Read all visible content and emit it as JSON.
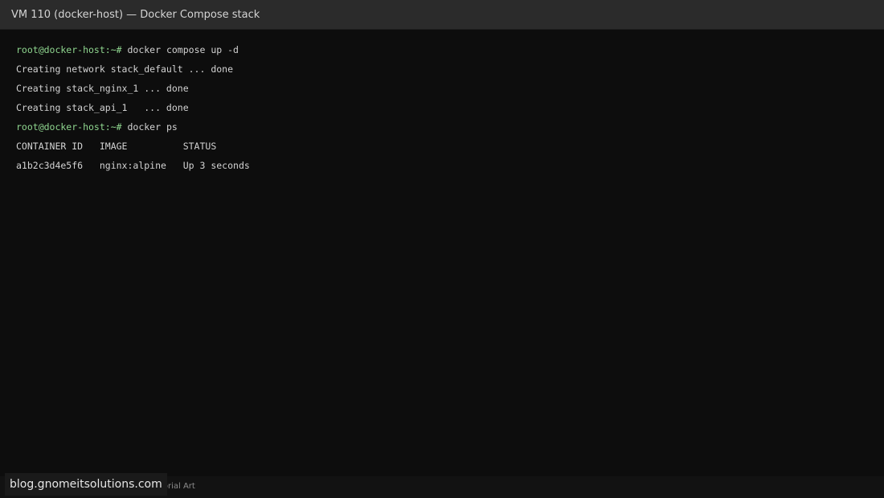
{
  "window": {
    "title": "VM 110 (docker-host) — Docker Compose stack"
  },
  "terminal": {
    "lines": [
      {
        "prompt": "root@docker-host:~#",
        "command": " docker compose up -d"
      },
      {
        "text": "Creating network stack_default ... done"
      },
      {
        "text": "Creating stack_nginx_1 ... done"
      },
      {
        "text": "Creating stack_api_1   ... done"
      },
      {
        "prompt": "root@docker-host:~#",
        "command": " docker ps"
      },
      {
        "text": "CONTAINER ID   IMAGE          STATUS"
      },
      {
        "text": "a1b2c3d4e5f6   nginx:alpine   Up 3 seconds"
      }
    ]
  },
  "footer": {
    "credit": "Tutorial Art"
  },
  "watermark": {
    "text": "blog.gnomeitsolutions.com"
  },
  "colors": {
    "background": "#0d0d0d",
    "titlebar": "#2b2b2b",
    "prompt": "#8fd68f",
    "text": "#d2d2d2"
  }
}
